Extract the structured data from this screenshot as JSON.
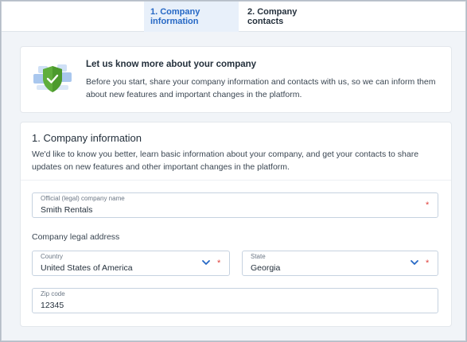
{
  "tabs": [
    {
      "label": "1. Company information",
      "active": true
    },
    {
      "label": "2. Company contacts",
      "active": false
    }
  ],
  "intro": {
    "illustration_icon": "shield-check-icon",
    "title": "Let us know more about your company",
    "text": "Before you start, share your company information and contacts with us, so we can inform them about new features and important changes in the platform."
  },
  "form": {
    "title": "1. Company information",
    "description": "We'd like to know you better, learn basic information about your company, and get your contacts to share updates on new features and other important changes in the platform.",
    "company_name": {
      "label": "Official (legal) company name",
      "value": "Smith Rentals",
      "required_mark": "*"
    },
    "address_section_label": "Company legal address",
    "country": {
      "label": "Country",
      "value": "United States of America",
      "required_mark": "*",
      "icon": "chevron-down-icon"
    },
    "state": {
      "label": "State",
      "value": "Georgia",
      "required_mark": "*",
      "icon": "chevron-down-icon"
    },
    "zip": {
      "label": "Zip code",
      "value": "12345"
    }
  },
  "colors": {
    "accent": "#2668c5",
    "required": "#e0413d",
    "shield": "#5fae3c"
  }
}
